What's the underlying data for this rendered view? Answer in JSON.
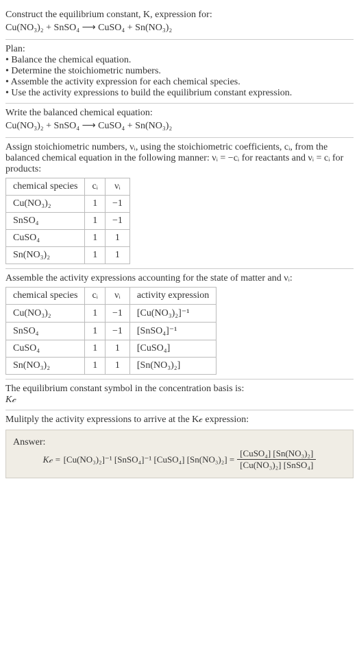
{
  "intro": {
    "line1": "Construct the equilibrium constant, K, expression for:",
    "equation": "Cu(NO₃)₂ + SnSO₄  ⟶  CuSO₄ + Sn(NO₃)₂"
  },
  "plan": {
    "heading": "Plan:",
    "b1": "• Balance the chemical equation.",
    "b2": "• Determine the stoichiometric numbers.",
    "b3": "• Assemble the activity expression for each chemical species.",
    "b4": "• Use the activity expressions to build the equilibrium constant expression."
  },
  "balanced": {
    "heading": "Write the balanced chemical equation:",
    "equation": "Cu(NO₃)₂ + SnSO₄  ⟶  CuSO₄ + Sn(NO₃)₂"
  },
  "stoich": {
    "intro": "Assign stoichiometric numbers, νᵢ, using the stoichiometric coefficients, cᵢ, from the balanced chemical equation in the following manner: νᵢ = −cᵢ for reactants and νᵢ = cᵢ for products:",
    "headers": {
      "species": "chemical species",
      "ci": "cᵢ",
      "vi": "νᵢ"
    },
    "rows": [
      {
        "species": "Cu(NO₃)₂",
        "ci": "1",
        "vi": "−1"
      },
      {
        "species": "SnSO₄",
        "ci": "1",
        "vi": "−1"
      },
      {
        "species": "CuSO₄",
        "ci": "1",
        "vi": "1"
      },
      {
        "species": "Sn(NO₃)₂",
        "ci": "1",
        "vi": "1"
      }
    ]
  },
  "activity": {
    "intro": "Assemble the activity expressions accounting for the state of matter and νᵢ:",
    "headers": {
      "species": "chemical species",
      "ci": "cᵢ",
      "vi": "νᵢ",
      "expr": "activity expression"
    },
    "rows": [
      {
        "species": "Cu(NO₃)₂",
        "ci": "1",
        "vi": "−1",
        "expr": "[Cu(NO₃)₂]⁻¹"
      },
      {
        "species": "SnSO₄",
        "ci": "1",
        "vi": "−1",
        "expr": "[SnSO₄]⁻¹"
      },
      {
        "species": "CuSO₄",
        "ci": "1",
        "vi": "1",
        "expr": "[CuSO₄]"
      },
      {
        "species": "Sn(NO₃)₂",
        "ci": "1",
        "vi": "1",
        "expr": "[Sn(NO₃)₂]"
      }
    ]
  },
  "symbol": {
    "line1": "The equilibrium constant symbol in the concentration basis is:",
    "kc": "K𝒸"
  },
  "multiply": {
    "line": "Mulitply the activity expressions to arrive at the K𝒸 expression:"
  },
  "answer": {
    "label": "Answer:",
    "kc": "K𝒸 =",
    "lhs": "[Cu(NO₃)₂]⁻¹ [SnSO₄]⁻¹ [CuSO₄] [Sn(NO₃)₂] =",
    "num": "[CuSO₄] [Sn(NO₃)₂]",
    "den": "[Cu(NO₃)₂] [SnSO₄]"
  }
}
